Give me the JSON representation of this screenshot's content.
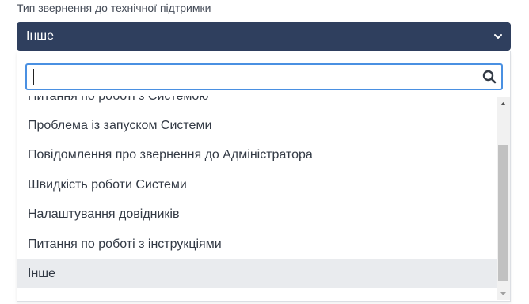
{
  "field": {
    "label": "Тип звернення до технічної підтримки",
    "selected_value": "Інше"
  },
  "search": {
    "value": "",
    "icon": "search-icon"
  },
  "options": [
    {
      "label": "Питання по роботі з Системою",
      "selected": false
    },
    {
      "label": "Проблема із запуском Системи",
      "selected": false
    },
    {
      "label": "Повідомлення про звернення до Адміністратора",
      "selected": false
    },
    {
      "label": "Швидкість роботи Системи",
      "selected": false
    },
    {
      "label": "Налаштування довідників",
      "selected": false
    },
    {
      "label": "Питання по роботі з інструкціями",
      "selected": false
    },
    {
      "label": "Інше",
      "selected": true
    }
  ],
  "colors": {
    "select_bg": "#2f3f5e",
    "focus_border": "#4a90e2",
    "selected_option_bg": "#e9ebee"
  }
}
